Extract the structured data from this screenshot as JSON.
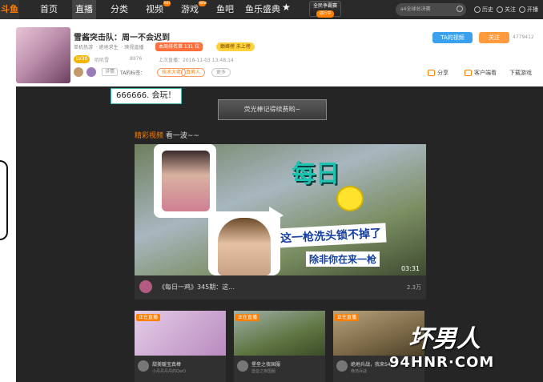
{
  "nav": {
    "logo": "斗鱼",
    "items": [
      {
        "label": "首页"
      },
      {
        "label": "直播"
      },
      {
        "label": "分类"
      },
      {
        "label": "视频"
      },
      {
        "label": "游戏"
      },
      {
        "label": "鱼吧"
      },
      {
        "label": "鱼乐盛典"
      }
    ],
    "hot_badges": [
      "hot",
      "new",
      "hot"
    ],
    "special": {
      "line1": "全民争霸赛",
      "line2": "进行中"
    },
    "search_placeholder": "a4全球总决赛",
    "icons": [
      {
        "label": "历史",
        "icon": "history-icon"
      },
      {
        "label": "关注",
        "icon": "heart-icon"
      },
      {
        "label": "开播",
        "icon": "broadcast-icon"
      }
    ]
  },
  "room": {
    "title": "雪酱突击队：周一不会迟到",
    "category": "单机热游",
    "sub_label": "绝地求生",
    "sub_extra": "映视直播",
    "rank_badge": "本周排名第 131 位",
    "rank_badge2": "巅峰榜 未上榜",
    "level": "LV30",
    "streamer": "叽叽雪",
    "fans": "8976",
    "last_live": "上次直播：2018-11-03 13:48:14",
    "detail_button": "详情",
    "tag_label": "TA的标签：",
    "tags": [
      "技术大佬",
      "真男人"
    ],
    "more_tag": "更多",
    "btn_video": "TA的视频",
    "btn_follow": "关注",
    "follow_count": "4779412",
    "actions": [
      {
        "label": "分享",
        "icon": "share-icon"
      },
      {
        "label": "客户端看",
        "icon": "monitor-icon"
      },
      {
        "label": "下载游戏",
        "icon": "download-icon"
      }
    ]
  },
  "player": {
    "chat_bubble": "666666. 会玩！",
    "banner": "荧光棒记得续费哟~",
    "section_title": "精彩视频",
    "section_suffix": "看一波~~",
    "video_logo": "每日",
    "caption1": "这一枪洗头锁不掉了",
    "caption2": "除非你在来一枪",
    "duration": "03:31",
    "video_title": "《每日一鸡》345期：这...",
    "view_count": "2.3万"
  },
  "thumbnails": [
    {
      "live": "正在直播",
      "name": "甜美暖宝真棒",
      "sub": "小丹丹丹丹的QwQ",
      "color": "#d6b6d6"
    },
    {
      "live": "正在直播",
      "name": "堡垒之夜国服",
      "sub": "堡垒之夜国服",
      "color": "#6b7d4a"
    },
    {
      "live": "正在直播",
      "name": "绝地兵战，我来S4",
      "sub": "绝地兵战",
      "color": "#8a7553"
    }
  ],
  "watermark": {
    "line1": "坏男人",
    "line2": "94HNR·COM"
  }
}
